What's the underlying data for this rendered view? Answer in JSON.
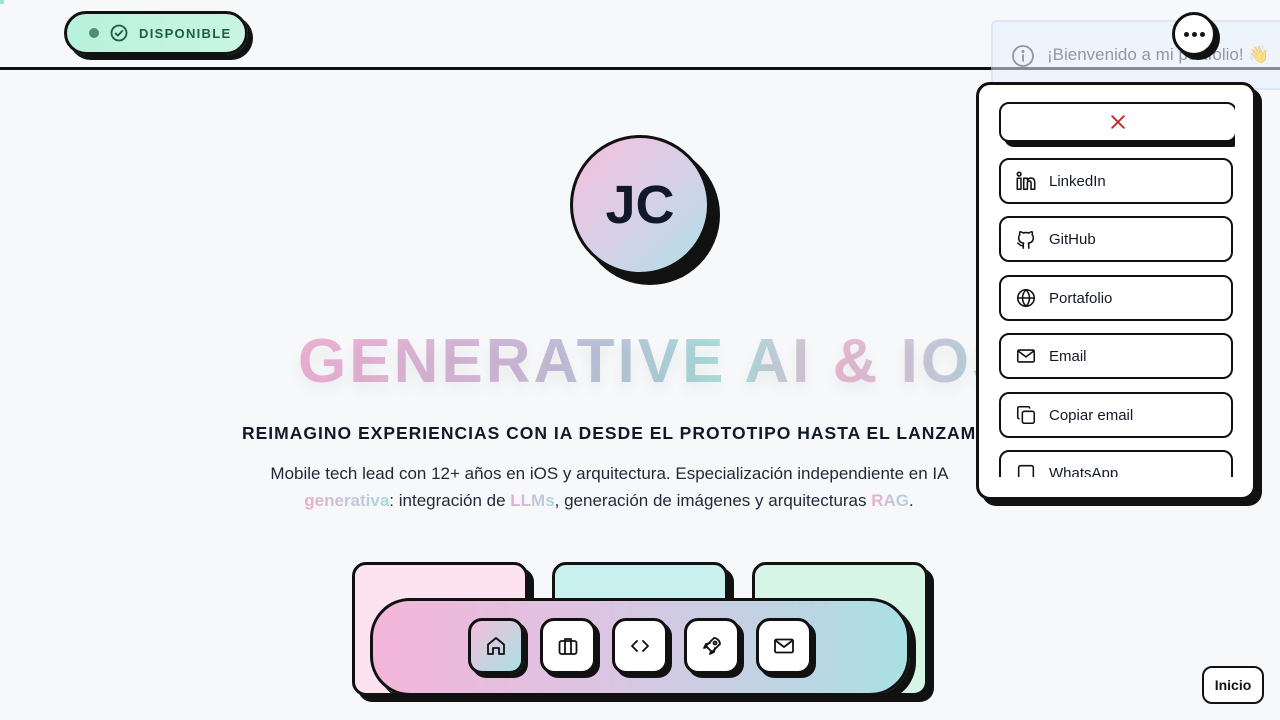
{
  "status_badge": {
    "label": "DISPONIBLE"
  },
  "toast": {
    "message": "¡Bienvenido a mi portfolio! 👋"
  },
  "avatar": {
    "initials": "JC"
  },
  "hero": {
    "title": "GENERATIVE AI & IOS",
    "subtitle": "REIMAGINO EXPERIENCIAS CON IA DESDE EL PROTOTIPO HASTA EL LANZAMIENTO",
    "desc_1": "Mobile tech lead con 12+ años en iOS y arquitectura. Especialización independiente en IA",
    "desc_hl_1": "generativa",
    "desc_2": ": integración de ",
    "desc_hl_2": "LLMs",
    "desc_3": ", generación de imágenes y arquitecturas ",
    "desc_hl_3": "RAG",
    "desc_4": "."
  },
  "dock": {
    "items": [
      {
        "icon": "home-icon",
        "active": true
      },
      {
        "icon": "briefcase-icon",
        "active": false
      },
      {
        "icon": "code-icon",
        "active": false
      },
      {
        "icon": "rocket-icon",
        "active": false
      },
      {
        "icon": "mail-icon",
        "active": false
      }
    ]
  },
  "social_panel": {
    "items": [
      {
        "label": "LinkedIn",
        "icon": "linkedin-icon"
      },
      {
        "label": "GitHub",
        "icon": "github-icon"
      },
      {
        "label": "Portafolio",
        "icon": "globe-icon"
      },
      {
        "label": "Email",
        "icon": "mail-icon"
      },
      {
        "label": "Copiar email",
        "icon": "copy-icon"
      },
      {
        "label": "WhatsApp",
        "icon": "whatsapp-icon"
      }
    ]
  },
  "footer": {
    "inicio_label": "Inicio"
  },
  "colors": {
    "accent_pink": "#f4b6d9",
    "accent_teal": "#a9e0e3",
    "status_green": "#1f5c46",
    "close_red": "#c62828"
  }
}
